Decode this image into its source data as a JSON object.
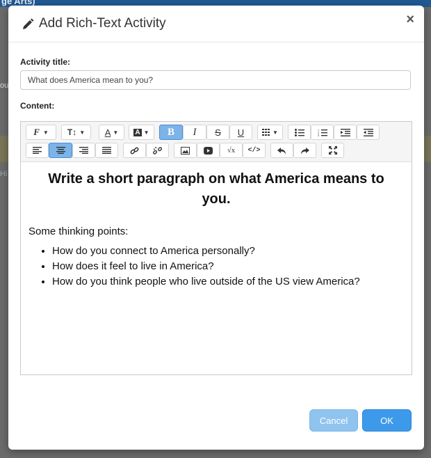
{
  "background": {
    "topbar_text": "ge Arts)",
    "edge_texts": [
      "ou",
      "Hi"
    ]
  },
  "modal": {
    "title": "Add Rich-Text Activity",
    "close_symbol": "×",
    "icon": "pencil-icon"
  },
  "form": {
    "title_label": "Activity title:",
    "title_value": "What does America mean to you?",
    "content_label": "Content:"
  },
  "toolbar": {
    "font_label": "F",
    "size_label": "T↕",
    "color_label": "A",
    "bold_label": "B",
    "italic_label": "I",
    "strike_label": "S",
    "underline_label": "U",
    "bold_active": true,
    "align_center_active": true,
    "active_color": "#7cb3e8"
  },
  "content": {
    "heading": "Write a short paragraph on what America means to you.",
    "intro": "Some thinking points:",
    "bullets": [
      "How do you connect to America personally?",
      "How does it feel to live in America?",
      "How do you think people who live outside of the US view America?"
    ]
  },
  "footer": {
    "cancel_label": "Cancel",
    "ok_label": "OK"
  }
}
